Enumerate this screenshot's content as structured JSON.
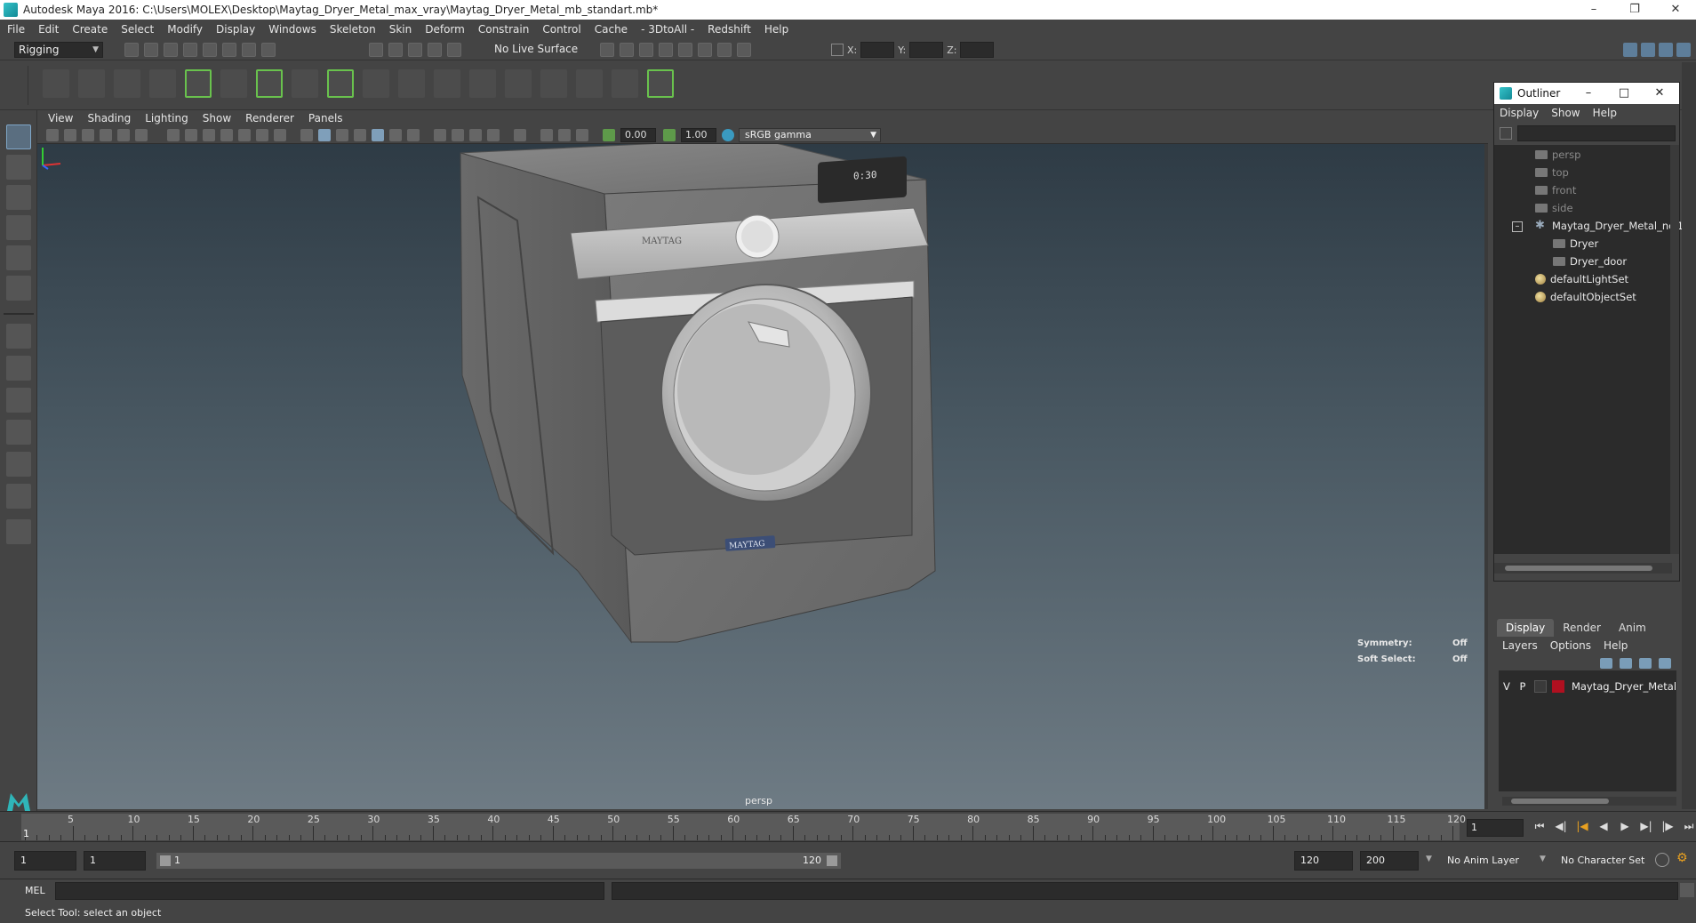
{
  "window": {
    "title": "Autodesk Maya 2016: C:\\Users\\MOLEX\\Desktop\\Maytag_Dryer_Metal_max_vray\\Maytag_Dryer_Metal_mb_standart.mb*"
  },
  "menubar": [
    "File",
    "Edit",
    "Create",
    "Select",
    "Modify",
    "Display",
    "Windows",
    "Skeleton",
    "Skin",
    "Deform",
    "Constrain",
    "Control",
    "Cache",
    "- 3DtoAll -",
    "Redshift",
    "Help"
  ],
  "statusline": {
    "mode": "Rigging",
    "live_surface": "No Live Surface",
    "x_label": "X:",
    "y_label": "Y:",
    "z_label": "Z:"
  },
  "viewport": {
    "menu": [
      "View",
      "Shading",
      "Lighting",
      "Show",
      "Renderer",
      "Panels"
    ],
    "exposure": "0.00",
    "gamma_value": "1.00",
    "color_space": "sRGB gamma",
    "camera_label": "persp",
    "symmetry_label": "Symmetry:",
    "symmetry_value": "Off",
    "soft_select_label": "Soft Select:",
    "soft_select_value": "Off",
    "panel_brand": "MAYTAG",
    "door_brand": "MAYTAG",
    "display_time": "0:30"
  },
  "outliner": {
    "title": "Outliner",
    "menu": [
      "Display",
      "Show",
      "Help"
    ],
    "items": [
      {
        "label": "persp",
        "icon": "camera-icon",
        "dim": true
      },
      {
        "label": "top",
        "icon": "camera-icon",
        "dim": true
      },
      {
        "label": "front",
        "icon": "camera-icon",
        "dim": true
      },
      {
        "label": "side",
        "icon": "camera-icon",
        "dim": true
      },
      {
        "label": "Maytag_Dryer_Metal_ncl1",
        "icon": "joint-icon",
        "dim": false
      },
      {
        "label": "Dryer",
        "icon": "mesh-icon",
        "dim": false
      },
      {
        "label": "Dryer_door",
        "icon": "mesh-icon",
        "dim": false
      },
      {
        "label": "defaultLightSet",
        "icon": "set-icon",
        "dim": false
      },
      {
        "label": "defaultObjectSet",
        "icon": "set-icon",
        "dim": false
      }
    ]
  },
  "layers": {
    "tabs": [
      "Display",
      "Render",
      "Anim"
    ],
    "menu": [
      "Layers",
      "Options",
      "Help"
    ],
    "row": {
      "v": "V",
      "p": "P",
      "name": "Maytag_Dryer_Metal",
      "color": "#b01020"
    }
  },
  "timeline": {
    "ticks": [
      "5",
      "10",
      "15",
      "20",
      "25",
      "30",
      "35",
      "40",
      "45",
      "50",
      "55",
      "60",
      "65",
      "70",
      "75",
      "80",
      "85",
      "90",
      "95",
      "100",
      "105",
      "110",
      "115",
      "120"
    ],
    "current": "1",
    "current_frame": "1"
  },
  "range": {
    "start": "1",
    "inner_start": "1",
    "slider_start": "1",
    "slider_end": "120",
    "end": "120",
    "outer_end": "200",
    "anim_layer": "No Anim Layer",
    "char_set": "No Character Set"
  },
  "cmd": {
    "lang": "MEL",
    "help": "Select Tool: select an object"
  }
}
